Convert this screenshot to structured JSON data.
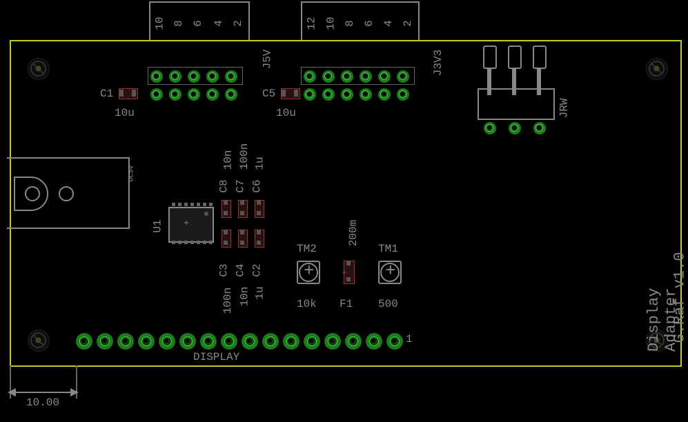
{
  "board": {
    "title1": "Display Adapter",
    "title2": "G.Raf v1.0",
    "dimension": "10.00"
  },
  "connectors": {
    "j5v": {
      "name": "J5V",
      "pins": [
        "10",
        "8",
        "6",
        "4",
        "2"
      ]
    },
    "j3v3": {
      "name": "J3V3",
      "pins": [
        "12",
        "10",
        "8",
        "6",
        "4",
        "2"
      ]
    },
    "jrw": {
      "name": "JRW"
    },
    "display": {
      "name": "DISPLAY",
      "pin1": "1"
    },
    "dc5v": {
      "name": "DC5V"
    }
  },
  "caps": {
    "c1": {
      "ref": "C1",
      "val": "10u"
    },
    "c5": {
      "ref": "C5",
      "val": "10u"
    },
    "c8": {
      "ref": "C8",
      "val": "10n"
    },
    "c7": {
      "ref": "C7",
      "val": "100n"
    },
    "c6": {
      "ref": "C6",
      "val": "1u"
    },
    "c3": {
      "ref": "C3",
      "val": "100n"
    },
    "c4": {
      "ref": "C4",
      "val": "10n"
    },
    "c2": {
      "ref": "C2",
      "val": "1u"
    }
  },
  "ic": {
    "ref": "U1"
  },
  "trimmers": {
    "tm1": {
      "ref": "TM1",
      "val": "500"
    },
    "tm2": {
      "ref": "TM2",
      "val": "10k"
    }
  },
  "fuse": {
    "ref": "F1",
    "val": "200m"
  }
}
